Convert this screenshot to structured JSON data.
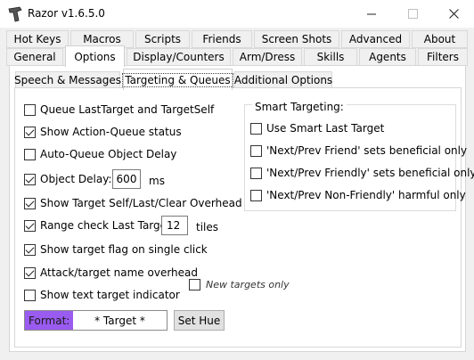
{
  "window": {
    "title": "Razor v1.6.5.0"
  },
  "tabs_row1": [
    "Hot Keys",
    "Macros",
    "Scripts",
    "Friends",
    "Screen Shots",
    "Advanced",
    "About"
  ],
  "tabs_row2": [
    "General",
    "Options",
    "Display/Counters",
    "Arm/Dress",
    "Skills",
    "Agents",
    "Filters"
  ],
  "active_tab": "Options",
  "subtabs": [
    "Speech & Messages",
    "Targeting & Queues",
    "Additional Options"
  ],
  "active_subtab": "Targeting & Queues",
  "options": {
    "queue_last_target": {
      "label": "Queue LastTarget and TargetSelf",
      "checked": false
    },
    "show_action_queue": {
      "label": "Show Action-Queue status",
      "checked": true
    },
    "auto_queue_object_delay": {
      "label": "Auto-Queue Object Delay",
      "checked": false
    },
    "object_delay": {
      "label": "Object Delay:",
      "checked": true,
      "value": "600",
      "unit": "ms"
    },
    "show_target_overhead": {
      "label": "Show Target Self/Last/Clear Overhead",
      "checked": true
    },
    "range_check": {
      "label": "Range check Last Target:",
      "checked": true,
      "value": "12",
      "unit": "tiles"
    },
    "show_target_flag": {
      "label": "Show target flag on single click",
      "checked": true
    },
    "attack_target_overhead": {
      "label": "Attack/target name overhead",
      "checked": true
    },
    "new_targets_only": {
      "label": "New targets only",
      "checked": false
    },
    "show_text_target": {
      "label": "Show text target indicator",
      "checked": false
    }
  },
  "smart_targeting": {
    "title": "Smart Targeting:",
    "items": [
      {
        "label": "Use Smart Last Target",
        "checked": false
      },
      {
        "label": "'Next/Prev Friend' sets beneficial only",
        "checked": false
      },
      {
        "label": "'Next/Prev Friendly' sets beneficial only",
        "checked": false
      },
      {
        "label": "'Next/Prev Non-Friendly' harmful only",
        "checked": false
      }
    ]
  },
  "format": {
    "label": "Format:",
    "value": "* Target *",
    "color": "#9a5bf0"
  },
  "set_hue_button": "Set Hue"
}
